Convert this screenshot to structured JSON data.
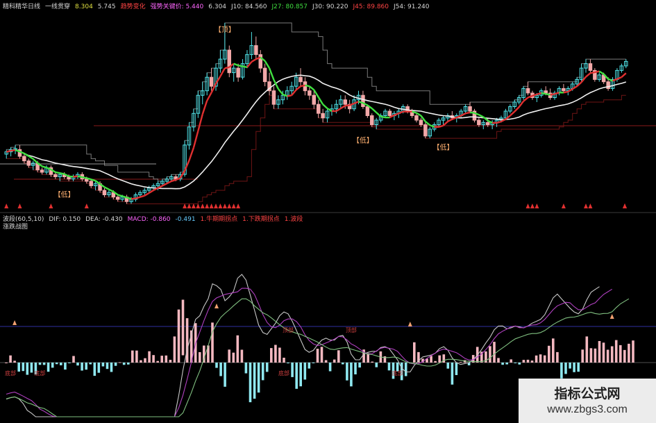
{
  "upper_header": {
    "items": [
      {
        "text": "精科精华日线",
        "color": "#d8d8d8"
      },
      {
        "text": "一线贯穿",
        "color": "#d8d8d8"
      },
      {
        "text": "8.304",
        "color": "#e0e040"
      },
      {
        "text": "5.745",
        "color": "#d8d8d8"
      },
      {
        "text": "趋势变化",
        "color": "#ff4444"
      },
      {
        "text": "强势关键价: 5.440",
        "color": "#ff66ff"
      },
      {
        "text": "6.304",
        "color": "#d8d8d8"
      },
      {
        "text": "J10: 84.560",
        "color": "#d8d8d8"
      },
      {
        "text": "J27: 80.857",
        "color": "#40e040"
      },
      {
        "text": "J30: 90.220",
        "color": "#d8d8d8"
      },
      {
        "text": "J45: 89.860",
        "color": "#ff4444"
      },
      {
        "text": "J54: 91.240",
        "color": "#d8d8d8"
      }
    ]
  },
  "lower_header": {
    "line1": [
      {
        "text": "波段(60,5,10)",
        "color": "#d8d8d8"
      },
      {
        "text": "DIF: 0.150",
        "color": "#d8d8d8"
      },
      {
        "text": "DEA: -0.430",
        "color": "#d8d8d8"
      },
      {
        "text": "MACD: -0.860",
        "color": "#ff66ff"
      },
      {
        "text": "-0.491",
        "color": "#66ccff"
      },
      {
        "text": "1.牛期期拐点",
        "color": "#ff4444"
      },
      {
        "text": "1.下跌期拐点",
        "color": "#ff4444"
      },
      {
        "text": "1.波段",
        "color": "#ff4444"
      }
    ],
    "line2": [
      {
        "text": "涨跌战图",
        "color": "#d8d8d8"
      }
    ]
  },
  "watermark": {
    "title": "指标公式网",
    "url": "www.zbgs3.com"
  },
  "colors": {
    "up": "#4fe3e8",
    "down": "#f2a8a8",
    "ma_red": "#e03030",
    "ma_green": "#40e040",
    "ma_white": "#f0f0f0",
    "line_gray": "#9a9a9a",
    "line_darkred": "#8b1a1a",
    "hist_pos": "#f4b8c0",
    "hist_neg": "#8fe8f0",
    "purple": "#b040c0",
    "green_line": "#80c080",
    "white_line": "#c8c8c8",
    "marker": "#e03030"
  },
  "chart_data": [
    {
      "type": "candlestick",
      "panel": "upper",
      "ylim": [
        4.3,
        8.6
      ],
      "x_count": 150,
      "candles": [
        [
          5.5,
          5.6,
          5.4,
          5.55
        ],
        [
          5.55,
          5.65,
          5.45,
          5.6
        ],
        [
          5.6,
          5.7,
          5.5,
          5.62
        ],
        [
          5.6,
          5.7,
          5.4,
          5.45
        ],
        [
          5.45,
          5.5,
          5.3,
          5.35
        ],
        [
          5.35,
          5.4,
          5.2,
          5.25
        ],
        [
          5.25,
          5.35,
          5.15,
          5.3
        ],
        [
          5.3,
          5.35,
          5.1,
          5.15
        ],
        [
          5.15,
          5.2,
          5.05,
          5.1
        ],
        [
          5.1,
          5.25,
          5.05,
          5.2
        ],
        [
          5.2,
          5.25,
          5.0,
          5.05
        ],
        [
          5.05,
          5.1,
          4.95,
          5.0
        ],
        [
          5.0,
          5.1,
          4.9,
          5.05
        ],
        [
          5.05,
          5.1,
          4.95,
          5.0
        ],
        [
          5.0,
          5.05,
          4.9,
          4.95
        ],
        [
          4.95,
          5.05,
          4.9,
          5.0
        ],
        [
          5.0,
          5.1,
          4.95,
          5.05
        ],
        [
          5.05,
          5.1,
          4.9,
          4.95
        ],
        [
          4.95,
          5.0,
          4.85,
          4.9
        ],
        [
          4.9,
          4.95,
          4.75,
          4.8
        ],
        [
          4.8,
          4.9,
          4.7,
          4.85
        ],
        [
          4.85,
          4.9,
          4.65,
          4.7
        ],
        [
          4.7,
          4.75,
          4.55,
          4.6
        ],
        [
          4.6,
          4.7,
          4.55,
          4.65
        ],
        [
          4.65,
          4.7,
          4.5,
          4.55
        ],
        [
          4.55,
          4.6,
          4.45,
          4.5
        ],
        [
          4.5,
          4.6,
          4.45,
          4.55
        ],
        [
          4.55,
          4.6,
          4.4,
          4.45
        ],
        [
          4.45,
          4.55,
          4.4,
          4.5
        ],
        [
          4.5,
          4.65,
          4.45,
          4.6
        ],
        [
          4.6,
          4.7,
          4.55,
          4.65
        ],
        [
          4.65,
          4.75,
          4.6,
          4.7
        ],
        [
          4.7,
          4.8,
          4.65,
          4.75
        ],
        [
          4.75,
          4.85,
          4.7,
          4.8
        ],
        [
          4.8,
          4.9,
          4.7,
          4.85
        ],
        [
          4.85,
          4.95,
          4.8,
          4.9
        ],
        [
          4.9,
          5.0,
          4.85,
          4.95
        ],
        [
          4.95,
          5.05,
          4.9,
          5.0
        ],
        [
          5.0,
          5.05,
          4.9,
          4.95
        ],
        [
          4.95,
          5.1,
          4.9,
          5.05
        ],
        [
          5.05,
          5.8,
          5.0,
          5.7
        ],
        [
          5.7,
          6.2,
          5.6,
          6.1
        ],
        [
          6.1,
          6.5,
          6.0,
          6.4
        ],
        [
          6.4,
          6.9,
          6.3,
          6.8
        ],
        [
          6.8,
          7.1,
          6.6,
          6.9
        ],
        [
          6.9,
          7.3,
          6.8,
          7.2
        ],
        [
          7.2,
          7.4,
          6.9,
          7.0
        ],
        [
          7.0,
          7.5,
          6.9,
          7.4
        ],
        [
          7.4,
          7.8,
          7.3,
          7.6
        ],
        [
          7.6,
          8.4,
          7.5,
          7.8
        ],
        [
          7.8,
          7.9,
          7.2,
          7.3
        ],
        [
          7.3,
          7.5,
          7.1,
          7.4
        ],
        [
          7.4,
          7.5,
          7.1,
          7.2
        ],
        [
          7.2,
          7.6,
          7.15,
          7.5
        ],
        [
          7.5,
          7.8,
          7.4,
          7.7
        ],
        [
          7.7,
          8.2,
          7.6,
          7.9
        ],
        [
          7.9,
          8.1,
          7.6,
          7.7
        ],
        [
          7.7,
          7.8,
          7.3,
          7.4
        ],
        [
          7.4,
          7.5,
          7.0,
          7.1
        ],
        [
          7.1,
          7.3,
          6.8,
          6.9
        ],
        [
          6.9,
          7.0,
          6.5,
          6.6
        ],
        [
          6.6,
          6.8,
          6.5,
          6.7
        ],
        [
          6.7,
          6.9,
          6.6,
          6.8
        ],
        [
          6.8,
          7.0,
          6.7,
          6.9
        ],
        [
          6.9,
          7.1,
          6.8,
          7.0
        ],
        [
          7.0,
          7.3,
          6.9,
          7.2
        ],
        [
          7.2,
          7.4,
          7.0,
          7.1
        ],
        [
          7.1,
          7.2,
          6.8,
          6.9
        ],
        [
          6.9,
          7.0,
          6.7,
          6.8
        ],
        [
          6.8,
          6.9,
          6.5,
          6.6
        ],
        [
          6.6,
          6.7,
          6.3,
          6.4
        ],
        [
          6.4,
          6.5,
          6.2,
          6.3
        ],
        [
          6.3,
          6.5,
          6.2,
          6.45
        ],
        [
          6.45,
          6.6,
          6.35,
          6.5
        ],
        [
          6.5,
          6.7,
          6.4,
          6.6
        ],
        [
          6.6,
          6.8,
          6.5,
          6.7
        ],
        [
          6.7,
          6.8,
          6.5,
          6.6
        ],
        [
          6.6,
          6.7,
          6.4,
          6.5
        ],
        [
          6.5,
          6.8,
          6.45,
          6.7
        ],
        [
          6.7,
          6.9,
          6.6,
          6.8
        ],
        [
          6.8,
          6.9,
          6.5,
          6.55
        ],
        [
          6.55,
          6.6,
          6.3,
          6.35
        ],
        [
          6.35,
          6.4,
          6.1,
          6.15
        ],
        [
          6.15,
          6.3,
          6.05,
          6.25
        ],
        [
          6.25,
          6.4,
          6.2,
          6.35
        ],
        [
          6.35,
          6.5,
          6.3,
          6.45
        ],
        [
          6.45,
          6.5,
          6.3,
          6.35
        ],
        [
          6.35,
          6.45,
          6.25,
          6.4
        ],
        [
          6.4,
          6.5,
          6.3,
          6.45
        ],
        [
          6.45,
          6.6,
          6.4,
          6.55
        ],
        [
          6.55,
          6.6,
          6.4,
          6.45
        ],
        [
          6.45,
          6.5,
          6.3,
          6.35
        ],
        [
          6.35,
          6.4,
          6.2,
          6.25
        ],
        [
          6.25,
          6.3,
          6.1,
          6.15
        ],
        [
          6.15,
          6.2,
          5.85,
          5.9
        ],
        [
          5.9,
          6.1,
          5.85,
          6.05
        ],
        [
          6.05,
          6.2,
          6.0,
          6.15
        ],
        [
          6.15,
          6.3,
          6.1,
          6.25
        ],
        [
          6.25,
          6.35,
          6.15,
          6.3
        ],
        [
          6.3,
          6.4,
          6.2,
          6.35
        ],
        [
          6.35,
          6.45,
          6.25,
          6.3
        ],
        [
          6.3,
          6.4,
          6.2,
          6.35
        ],
        [
          6.35,
          6.5,
          6.3,
          6.45
        ],
        [
          6.45,
          6.6,
          6.4,
          6.55
        ],
        [
          6.55,
          6.65,
          6.4,
          6.45
        ],
        [
          6.45,
          6.5,
          6.2,
          6.25
        ],
        [
          6.25,
          6.3,
          6.1,
          6.15
        ],
        [
          6.15,
          6.25,
          6.05,
          6.2
        ],
        [
          6.2,
          6.3,
          6.1,
          6.15
        ],
        [
          6.15,
          6.25,
          6.05,
          6.2
        ],
        [
          6.2,
          6.3,
          6.1,
          6.25
        ],
        [
          6.25,
          6.35,
          6.2,
          6.3
        ],
        [
          6.3,
          6.5,
          6.25,
          6.45
        ],
        [
          6.45,
          6.6,
          6.4,
          6.55
        ],
        [
          6.55,
          6.7,
          6.5,
          6.65
        ],
        [
          6.65,
          6.8,
          6.6,
          6.75
        ],
        [
          6.75,
          7.0,
          6.7,
          6.95
        ],
        [
          6.95,
          7.1,
          6.8,
          6.85
        ],
        [
          6.85,
          6.9,
          6.7,
          6.75
        ],
        [
          6.75,
          6.85,
          6.65,
          6.8
        ],
        [
          6.8,
          6.95,
          6.75,
          6.9
        ],
        [
          6.9,
          7.0,
          6.8,
          6.85
        ],
        [
          6.85,
          6.95,
          6.7,
          6.75
        ],
        [
          6.75,
          6.9,
          6.7,
          6.85
        ],
        [
          6.85,
          7.0,
          6.8,
          6.95
        ],
        [
          6.95,
          7.05,
          6.85,
          6.9
        ],
        [
          6.9,
          7.0,
          6.8,
          6.95
        ],
        [
          6.95,
          7.1,
          6.9,
          7.05
        ],
        [
          7.05,
          7.2,
          7.0,
          7.15
        ],
        [
          7.15,
          7.5,
          7.1,
          7.4
        ],
        [
          7.4,
          7.6,
          7.3,
          7.5
        ],
        [
          7.5,
          7.6,
          7.3,
          7.35
        ],
        [
          7.35,
          7.4,
          7.1,
          7.15
        ],
        [
          7.15,
          7.3,
          7.1,
          7.25
        ],
        [
          7.25,
          7.3,
          7.05,
          7.1
        ],
        [
          7.1,
          7.2,
          6.9,
          6.95
        ],
        [
          6.95,
          7.2,
          6.9,
          7.15
        ],
        [
          7.15,
          7.4,
          7.1,
          7.35
        ],
        [
          7.35,
          7.5,
          7.3,
          7.45
        ],
        [
          7.45,
          7.6,
          7.4,
          7.55
        ]
      ],
      "labels": [
        {
          "text": "【顶】",
          "x": 49,
          "y": 8.2
        },
        {
          "text": "【低】",
          "x": 13,
          "y": 4.55
        },
        {
          "text": "【低】",
          "x": 80,
          "y": 5.75
        },
        {
          "text": "【低】",
          "x": 98,
          "y": 5.6
        }
      ]
    },
    {
      "type": "macd",
      "panel": "lower",
      "ylim": [
        -1.0,
        1.0
      ],
      "x_count": 150,
      "labels": [
        {
          "text": "底部",
          "x": 1
        },
        {
          "text": "底部",
          "x": 8
        },
        {
          "text": "底部",
          "x": 66
        },
        {
          "text": "底部",
          "x": 93
        },
        {
          "text": "顶部",
          "x": 82
        },
        {
          "text": "顶部",
          "x": 67
        }
      ]
    }
  ]
}
